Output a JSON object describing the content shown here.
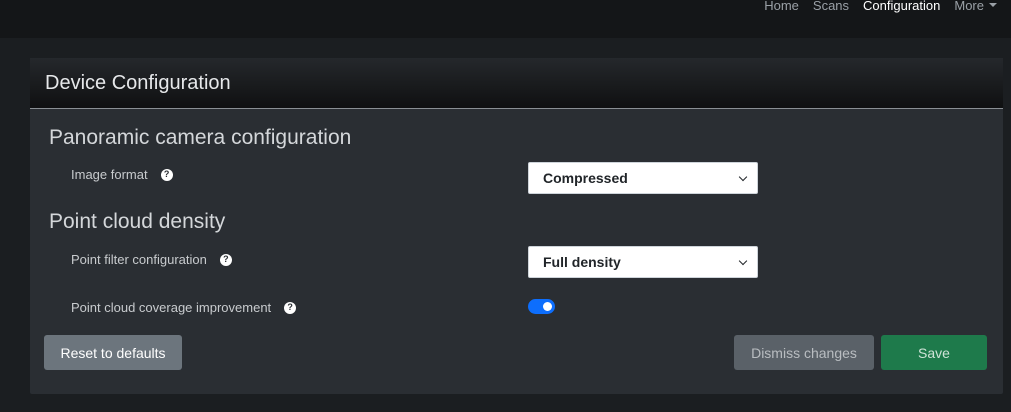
{
  "nav": {
    "items": [
      {
        "label": "Home"
      },
      {
        "label": "Scans"
      },
      {
        "label": "Configuration"
      },
      {
        "label": "More"
      }
    ],
    "active": "Configuration"
  },
  "card": {
    "title": "Device Configuration"
  },
  "panoramic": {
    "title": "Panoramic camera configuration",
    "image_format": {
      "label": "Image format",
      "value": "Compressed",
      "help_icon": "question-circle-icon"
    }
  },
  "point_cloud": {
    "title": "Point cloud density",
    "filter": {
      "label": "Point filter configuration",
      "value": "Full density",
      "help_icon": "question-circle-icon"
    },
    "coverage": {
      "label": "Point cloud coverage improvement",
      "enabled": true,
      "help_icon": "question-circle-icon"
    }
  },
  "buttons": {
    "reset": "Reset to defaults",
    "dismiss": "Dismiss changes",
    "save": "Save"
  },
  "colors": {
    "accent": "#0d6efd",
    "save": "#1e7a4b",
    "secondary": "#6c757d"
  }
}
